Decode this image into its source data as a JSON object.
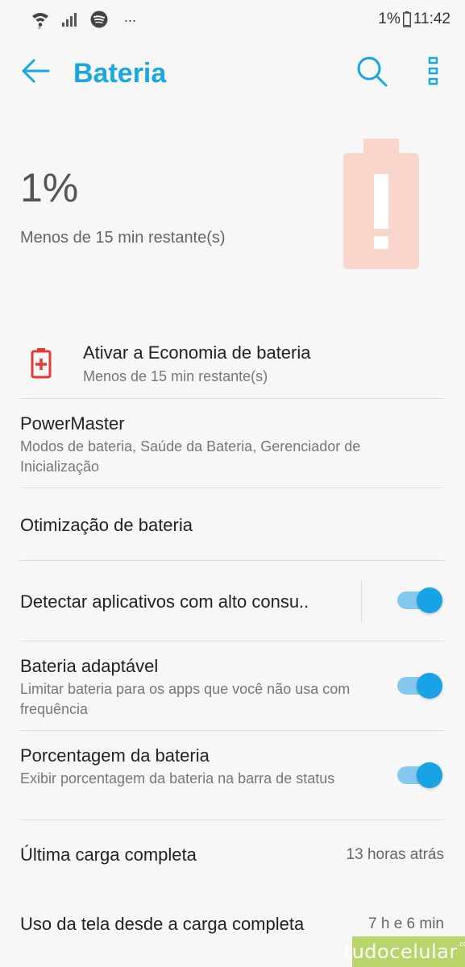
{
  "statusbar": {
    "more": "...",
    "battery_pct": "1%",
    "time": "11:42"
  },
  "appbar": {
    "title": "Bateria"
  },
  "battery": {
    "percent": "1%",
    "remaining": "Menos de 15 min restante(s)",
    "level": 0.01
  },
  "rows": {
    "saver": {
      "title": "Ativar a Economia de bateria",
      "subtitle": "Menos de 15 min restante(s)"
    },
    "powermaster": {
      "title": "PowerMaster",
      "subtitle": "Modos de bateria, Saúde da Bateria, Gerenciador de Inicialização"
    },
    "optimization": {
      "title": "Otimização de bateria"
    },
    "detect": {
      "title": "Detectar aplicativos com alto consu..",
      "enabled": true
    },
    "adaptive": {
      "title": "Bateria adaptável",
      "subtitle": "Limitar bateria para os apps que você não usa com frequência",
      "enabled": true
    },
    "percentage": {
      "title": "Porcentagem da bateria",
      "subtitle": "Exibir porcentagem da bateria na barra de status",
      "enabled": true
    },
    "last_charge": {
      "title": "Última carga completa",
      "value": "13 horas atrás"
    },
    "screen_usage": {
      "title": "Uso da tela desde a carga completa",
      "value": "7 h e 6 min"
    }
  },
  "watermark": {
    "text": "tudocelular",
    "suffix": ".com"
  },
  "colors": {
    "accent": "#1aa6df",
    "toggle_thumb": "#18a3e5",
    "toggle_track": "#86c9ee",
    "battery_warning": "#f9d5cc",
    "saver_icon": "#e53935"
  }
}
